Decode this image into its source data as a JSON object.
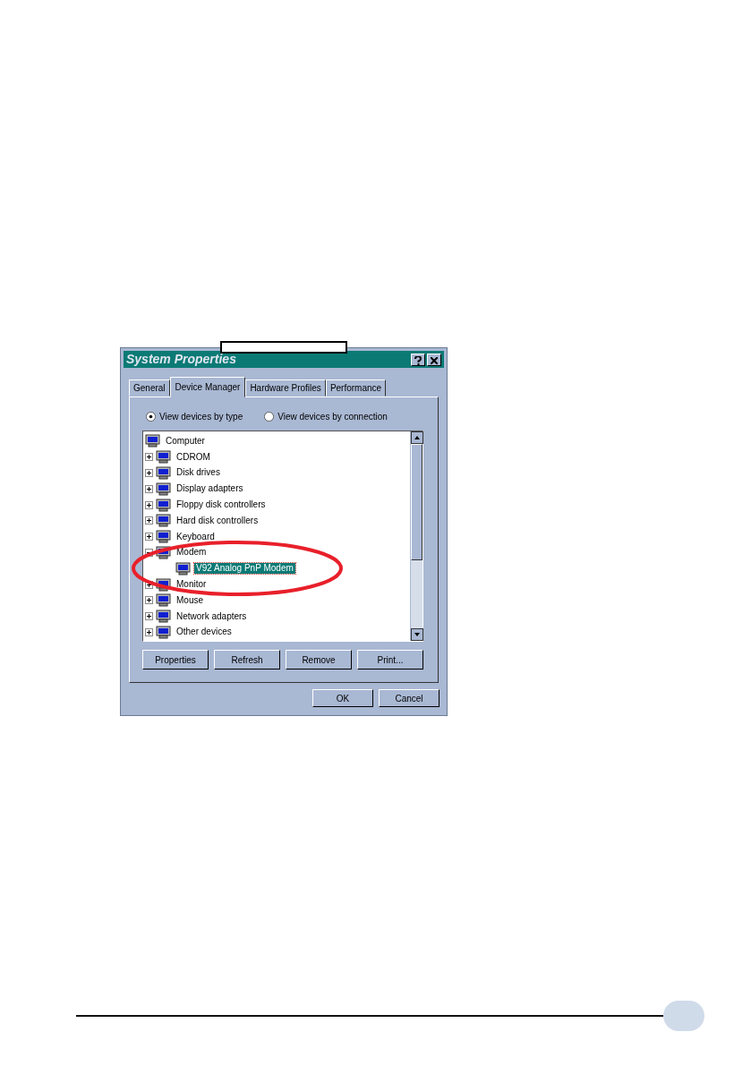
{
  "window": {
    "title": "System Properties"
  },
  "tabs": [
    {
      "label": "General",
      "selected": false
    },
    {
      "label": "Device Manager",
      "selected": true
    },
    {
      "label": "Hardware Profiles",
      "selected": false
    },
    {
      "label": "Performance",
      "selected": false
    }
  ],
  "view_options": [
    {
      "label": "View devices by type",
      "selected": true
    },
    {
      "label": "View devices by connection",
      "selected": false
    }
  ],
  "device_tree": [
    {
      "label": "Computer",
      "selected": false,
      "children": [
        {
          "label": "CDROM",
          "expanded": false,
          "selected": false
        },
        {
          "label": "Disk drives",
          "expanded": false,
          "selected": false
        },
        {
          "label": "Display adapters",
          "expanded": false,
          "selected": false
        },
        {
          "label": "Floppy disk controllers",
          "expanded": false,
          "selected": false
        },
        {
          "label": "Hard disk controllers",
          "expanded": false,
          "selected": false
        },
        {
          "label": "Keyboard",
          "expanded": false,
          "selected": false
        },
        {
          "label": "Modem",
          "expanded": true,
          "selected": false,
          "children": [
            {
              "label": "V92 Analog PnP Modem",
              "selected": true
            }
          ]
        },
        {
          "label": "Monitor",
          "expanded": false,
          "selected": false
        },
        {
          "label": "Mouse",
          "expanded": false,
          "selected": false
        },
        {
          "label": "Network adapters",
          "expanded": false,
          "selected": false
        },
        {
          "label": "Other devices",
          "expanded": false,
          "selected": false
        }
      ]
    }
  ],
  "device_buttons": [
    "Properties",
    "Refresh",
    "Remove",
    "Print..."
  ],
  "dialog_buttons": [
    "OK",
    "Cancel"
  ]
}
